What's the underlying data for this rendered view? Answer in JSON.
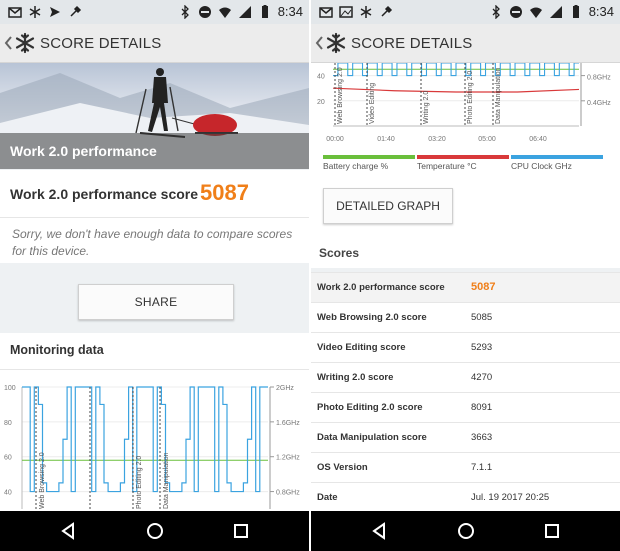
{
  "status": {
    "time": "8:34"
  },
  "header": {
    "title": "SCORE DETAILS"
  },
  "left": {
    "hero_label": "Work 2.0 performance",
    "hero_label_suffix": "2.0",
    "score_label": "Work 2.0 performance score",
    "score_value": "5087",
    "message": "Sorry, we don't have enough data to compare scores for this device.",
    "share_label": "SHARE",
    "monitoring_title": "Monitoring data",
    "chart_y_left": [
      "100",
      "80",
      "60",
      "40"
    ],
    "chart_y_right": [
      "2GHz",
      "1.6GHz",
      "1.2GHz",
      "0.8GHz"
    ],
    "chart_bottom_labels": [
      "Web Browsing 2.0",
      "Photo Editing 2.0",
      "Data Manipulation"
    ]
  },
  "right": {
    "chart_y_left": [
      "40",
      "20"
    ],
    "chart_y_right": [
      "0.8GHz",
      "0.4GHz"
    ],
    "chart_x": [
      "00:00",
      "01:40",
      "03:20",
      "05:00",
      "06:40"
    ],
    "chart_markers": [
      "Web Browsing 2.0",
      "Video Editing",
      "Writing 2.0",
      "Photo Editing 2.0",
      "Data Manipulation"
    ],
    "legend": [
      {
        "label": "Battery charge %",
        "color": "#6abf3b"
      },
      {
        "label": "Temperature °C",
        "color": "#d9393a"
      },
      {
        "label": "CPU Clock GHz",
        "color": "#3ba3e0"
      }
    ],
    "detailed_graph_label": "DETAILED GRAPH",
    "scores_title": "Scores",
    "scores": [
      {
        "k": "Work 2.0 performance score",
        "v": "5087"
      },
      {
        "k": "Web Browsing 2.0 score",
        "v": "5085"
      },
      {
        "k": "Video Editing score",
        "v": "5293"
      },
      {
        "k": "Writing 2.0 score",
        "v": "4270"
      },
      {
        "k": "Photo Editing 2.0 score",
        "v": "8091"
      },
      {
        "k": "Data Manipulation score",
        "v": "3663"
      },
      {
        "k": "OS Version",
        "v": "7.1.1"
      },
      {
        "k": "Date",
        "v": "Jul. 19 2017 20:25"
      }
    ]
  },
  "chart_data": [
    {
      "type": "line",
      "title": "Monitoring data",
      "ylim": [
        30,
        100
      ],
      "y2lim": [
        "0.8GHz",
        "2GHz"
      ],
      "series": [
        {
          "name": "Battery charge %",
          "color": "#6abf3b",
          "values": [
            58,
            58,
            58,
            58,
            58,
            58,
            58,
            58,
            58,
            58
          ]
        },
        {
          "name": "CPU Clock GHz",
          "color": "#3ba3e0",
          "values": [
            100,
            40,
            100,
            70,
            40,
            100,
            45,
            100,
            40,
            90
          ]
        }
      ]
    },
    {
      "type": "line",
      "x": [
        "00:00",
        "01:40",
        "03:20",
        "05:00",
        "06:40"
      ],
      "series": [
        {
          "name": "Battery charge %",
          "color": "#6abf3b",
          "values": [
            45,
            45,
            45,
            45,
            45
          ]
        },
        {
          "name": "Temperature °C",
          "color": "#d9393a",
          "values": [
            30,
            28,
            27,
            27,
            29
          ]
        },
        {
          "name": "CPU Clock GHz",
          "color": "#3ba3e0",
          "values": [
            0.8,
            0.9,
            0.8,
            0.9,
            0.8
          ]
        }
      ]
    }
  ]
}
